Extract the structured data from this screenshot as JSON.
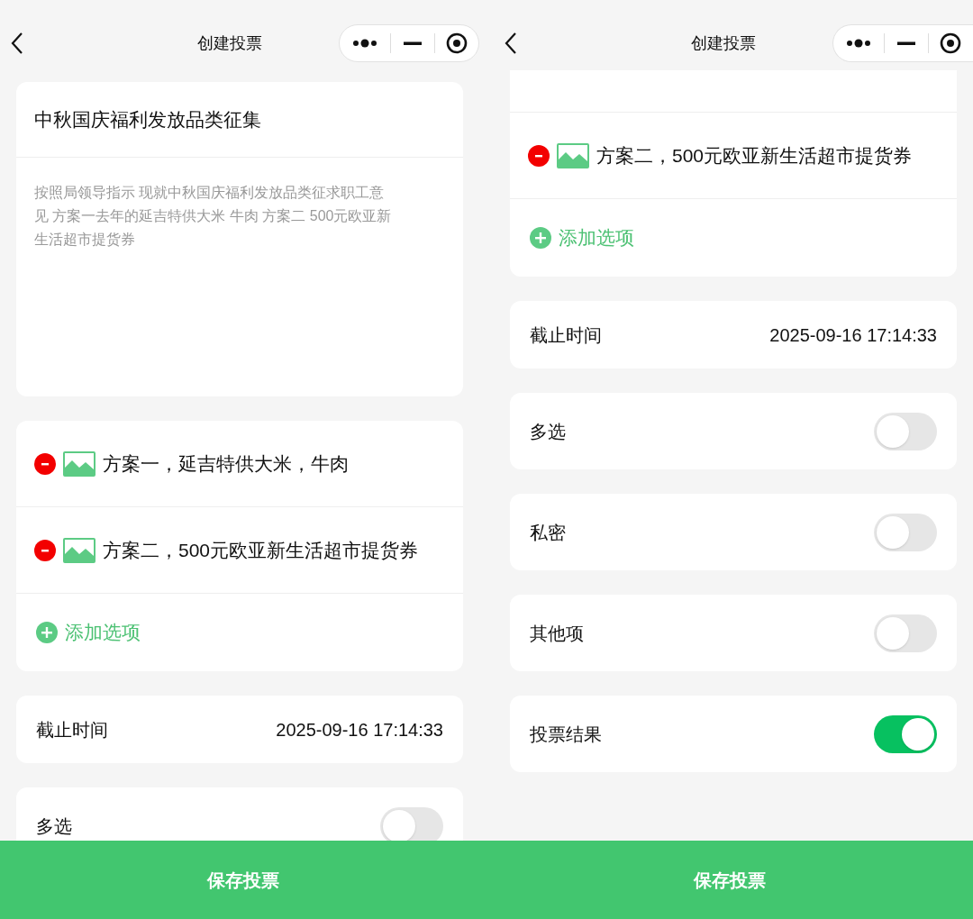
{
  "screens": [
    {
      "header": {
        "title": "创建投票"
      },
      "cards": [
        {
          "kind": "topic",
          "title": "中秋国庆福利发放品类征集",
          "description": "按照局领导指示 现就中秋国庆福利发放品类征求职工意见 方案一去年的延吉特供大米 牛肉 方案二 500元欧亚新生活超市提货券"
        },
        {
          "kind": "options",
          "options": [
            {
              "text": "方案一，延吉特供大米，牛肉"
            },
            {
              "text": "方案二，500元欧亚新生活超市提货券"
            }
          ],
          "add_label": "添加选项"
        },
        {
          "kind": "value",
          "label": "截止时间",
          "value": "2025-09-16 17:14:33"
        },
        {
          "kind": "toggle",
          "label": "多选",
          "on": false
        }
      ],
      "save_button": "保存投票"
    },
    {
      "header": {
        "title": "创建投票"
      },
      "cards": [
        {
          "kind": "options",
          "cut_top": true,
          "options": [
            {
              "text": "方案二，500元欧亚新生活超市提货券"
            }
          ],
          "add_label": "添加选项"
        },
        {
          "kind": "value",
          "label": "截止时间",
          "value": "2025-09-16 17:14:33"
        },
        {
          "kind": "toggle",
          "label": "多选",
          "on": false
        },
        {
          "kind": "toggle",
          "label": "私密",
          "on": false
        },
        {
          "kind": "toggle",
          "label": "其他项",
          "on": false
        },
        {
          "kind": "toggle",
          "label": "投票结果",
          "on": true
        }
      ],
      "save_button": "保存投票"
    }
  ]
}
